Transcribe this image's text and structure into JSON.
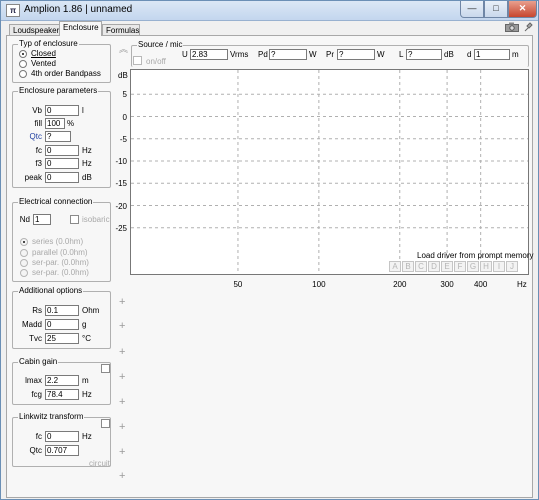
{
  "window": {
    "title": "Amplion 1.86 | unnamed",
    "app_icon": "π"
  },
  "tabs": [
    "Loudspeaker",
    "Enclosure",
    "Formulas"
  ],
  "enclosure_type": {
    "legend": "Typ of enclosure",
    "options": [
      "Closed",
      "Vented",
      "4th order Bandpass"
    ],
    "selected": "Closed"
  },
  "enclosure_params": {
    "legend": "Enclosure parameters",
    "rows": [
      {
        "label": "Vb",
        "value": "0",
        "unit": "l"
      },
      {
        "label": "fill",
        "value": "100",
        "unit": "%"
      },
      {
        "label": "Qtc",
        "value": "?",
        "unit": ""
      },
      {
        "label": "fc",
        "value": "0",
        "unit": "Hz"
      },
      {
        "label": "f3",
        "value": "0",
        "unit": "Hz"
      },
      {
        "label": "peak",
        "value": "0",
        "unit": "dB"
      }
    ]
  },
  "electrical": {
    "legend": "Electrical connection",
    "nd_label": "Nd",
    "nd_value": "1",
    "isobaric_label": "isobaric",
    "options": [
      "series (0.0hm)",
      "parallel (0.0hm)",
      "ser-par. (0.0hm)",
      "ser-par. (0.0hm)"
    ]
  },
  "additional": {
    "legend": "Additional options",
    "rows": [
      {
        "label": "Rs",
        "value": "0.1",
        "unit": "Ohm"
      },
      {
        "label": "Madd",
        "value": "0",
        "unit": "g"
      },
      {
        "label": "Tvc",
        "value": "25",
        "unit": "°C"
      }
    ]
  },
  "cabin_gain": {
    "legend": "Cabin gain",
    "rows": [
      {
        "label": "lmax",
        "value": "2.2",
        "unit": "m"
      },
      {
        "label": "fcg",
        "value": "78.4",
        "unit": "Hz"
      }
    ]
  },
  "linkwitz": {
    "legend": "Linkwitz transform",
    "rows": [
      {
        "label": "fc",
        "value": "0",
        "unit": "Hz"
      },
      {
        "label": "Qtc",
        "value": "0.707",
        "unit": ""
      }
    ],
    "footer": "circuit"
  },
  "source": {
    "legend": "Source / mic",
    "onoff_label": "on/off",
    "fields": [
      {
        "label": "U",
        "value": "2.83",
        "unit": "Vrms"
      },
      {
        "label": "Pd",
        "value": "?",
        "unit": "W"
      },
      {
        "label": "Pr",
        "value": "?",
        "unit": "W"
      },
      {
        "label": "L",
        "value": "?",
        "unit": "dB"
      },
      {
        "label": "d",
        "value": "1",
        "unit": "m"
      }
    ]
  },
  "load_driver": {
    "label": "Load driver from prompt memory",
    "slots": [
      "A",
      "B",
      "C",
      "D",
      "E",
      "F",
      "G",
      "H",
      "I",
      "J"
    ]
  },
  "chart_data": {
    "type": "line",
    "title": "",
    "ylabel": "dB",
    "xlabel": "Hz",
    "x_scale": "log",
    "xlim": [
      20,
      600
    ],
    "ylim": [
      -30,
      10
    ],
    "y_ticks": [
      5,
      0,
      -5,
      -10,
      -15,
      -20,
      -25
    ],
    "x_ticks": [
      50,
      100,
      200,
      300,
      400
    ],
    "grid": true,
    "series": []
  },
  "icons": {
    "camera": "camera-icon",
    "pin": "pin-icon",
    "collapse": "chevron-up-icon",
    "add": "plus-icon"
  }
}
